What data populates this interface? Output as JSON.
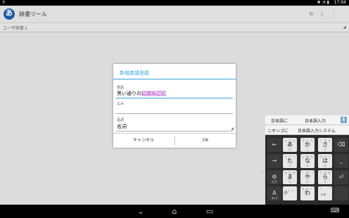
{
  "status": {
    "left_icon": "usb-icon",
    "time": "17:04",
    "icons": [
      "bluetooth-icon",
      "wifi-icon",
      "battery-icon"
    ]
  },
  "app": {
    "title": "辞書ツール",
    "icon_letter": "あ",
    "actions": [
      "add-icon",
      "delete-icon",
      "overflow-menu-icon"
    ]
  },
  "dictionary": {
    "label": "ユーザ辞書１"
  },
  "dialog": {
    "title": "新規単語登録",
    "word_label": "単語",
    "word_value": "黒い通りの",
    "word_composing": "にほんごに",
    "reading_label": "よみ",
    "reading_value": "",
    "pos_label": "品詞",
    "pos_value": "名詞",
    "cancel_label": "キャンセル",
    "ok_label": "OK"
  },
  "keyboard": {
    "candidates_row1": [
      "日本語に",
      "日本語入力"
    ],
    "candidates_row2": [
      "ニホンゴに",
      "日本語入力システム"
    ],
    "expand_icon": "chevron-down-icon",
    "rows": [
      [
        {
          "main": "←",
          "name": "left-arrow-icon",
          "func": true
        },
        {
          "main": "あ",
          "tl": "い",
          "tc": "う",
          "tr": "え",
          "bc": "お"
        },
        {
          "main": "か",
          "tl": "き",
          "tc": "く",
          "tr": "け",
          "bc": "こ"
        },
        {
          "main": "さ",
          "tl": "し",
          "tc": "す",
          "tr": "せ",
          "bc": "そ"
        },
        {
          "main": "⌫",
          "name": "backspace-icon",
          "func": true
        }
      ],
      [
        {
          "main": "→",
          "name": "right-arrow-icon",
          "func": true
        },
        {
          "main": "た",
          "tl": "ち",
          "tc": "つ",
          "tr": "て",
          "bc": "と"
        },
        {
          "main": "な",
          "tl": "に",
          "tc": "ぬ",
          "tr": "ね",
          "bc": "の"
        },
        {
          "main": "は",
          "tl": "ひ",
          "tc": "ふ",
          "tr": "へ",
          "bc": "ほ"
        },
        {
          "main": "⎵",
          "name": "space-icon",
          "func": true
        }
      ],
      [
        {
          "main": "⚙",
          "name": "settings-icon",
          "func": true,
          "sub": "記号"
        },
        {
          "main": "ま",
          "tl": "み",
          "tc": "む",
          "tr": "め",
          "bc": "も"
        },
        {
          "main": "や",
          "tl": "(",
          "tc": "ゆ",
          "tr": ")",
          "bc": "よ"
        },
        {
          "main": "ら",
          "tl": "り",
          "tc": "る",
          "tr": "れ",
          "bc": "ろ"
        },
        {
          "main": "⏎",
          "name": "enter-icon",
          "func": true
        }
      ],
      [
        {
          "main": "A",
          "name": "input-mode-toggle",
          "func": true,
          "sub": "あa1"
        },
        {
          "main": "小゛゜",
          "small": true
        },
        {
          "main": "わ",
          "tl": "を",
          "tc": "ん",
          "tr": "ー",
          "bc": ""
        },
        {
          "main": "、。",
          "tl": "?",
          "tr": "!",
          "bc": "…"
        },
        {
          "main": "",
          "func": true,
          "blank": true
        }
      ]
    ]
  },
  "nav": {
    "back_icon": "back-icon",
    "home_icon": "home-icon",
    "recents_icon": "recents-icon",
    "keyboard_icon": "keyboard-icon"
  },
  "colors": {
    "accent": "#33a4d8",
    "composing": "#c02cc4"
  }
}
